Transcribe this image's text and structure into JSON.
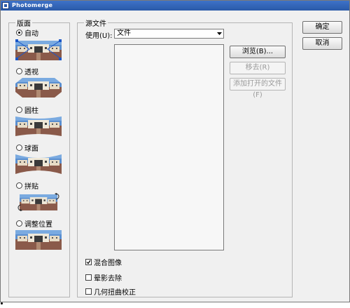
{
  "window": {
    "title": "Photomerge"
  },
  "layout_group": {
    "legend": "版面",
    "options": [
      {
        "label": "自动",
        "selected": true
      },
      {
        "label": "透视",
        "selected": false
      },
      {
        "label": "圆柱",
        "selected": false
      },
      {
        "label": "球面",
        "selected": false
      },
      {
        "label": "拼贴",
        "selected": false
      },
      {
        "label": "调整位置",
        "selected": false
      }
    ]
  },
  "source_group": {
    "legend": "源文件",
    "use_label": "使用(U):",
    "use_value": "文件",
    "buttons": {
      "browse": "浏览(B)...",
      "remove": "移去(R)",
      "add_open": "添加打开的文件(F)"
    }
  },
  "checkboxes": [
    {
      "label": "混合图像",
      "checked": true
    },
    {
      "label": "晕影去除",
      "checked": false
    },
    {
      "label": "几何扭曲校正",
      "checked": false
    }
  ],
  "dialog_buttons": {
    "ok": "确定",
    "cancel": "取消"
  },
  "colors": {
    "title_bar": "#2a5aa8",
    "sky": "#5a8fd0",
    "ground": "#8a5a4a",
    "building": "#efe8d8"
  },
  "icons": {
    "dropdown": "chevron-down-icon",
    "checkmark": "checkmark-icon",
    "rotate": "rotate-arrows-icon"
  }
}
